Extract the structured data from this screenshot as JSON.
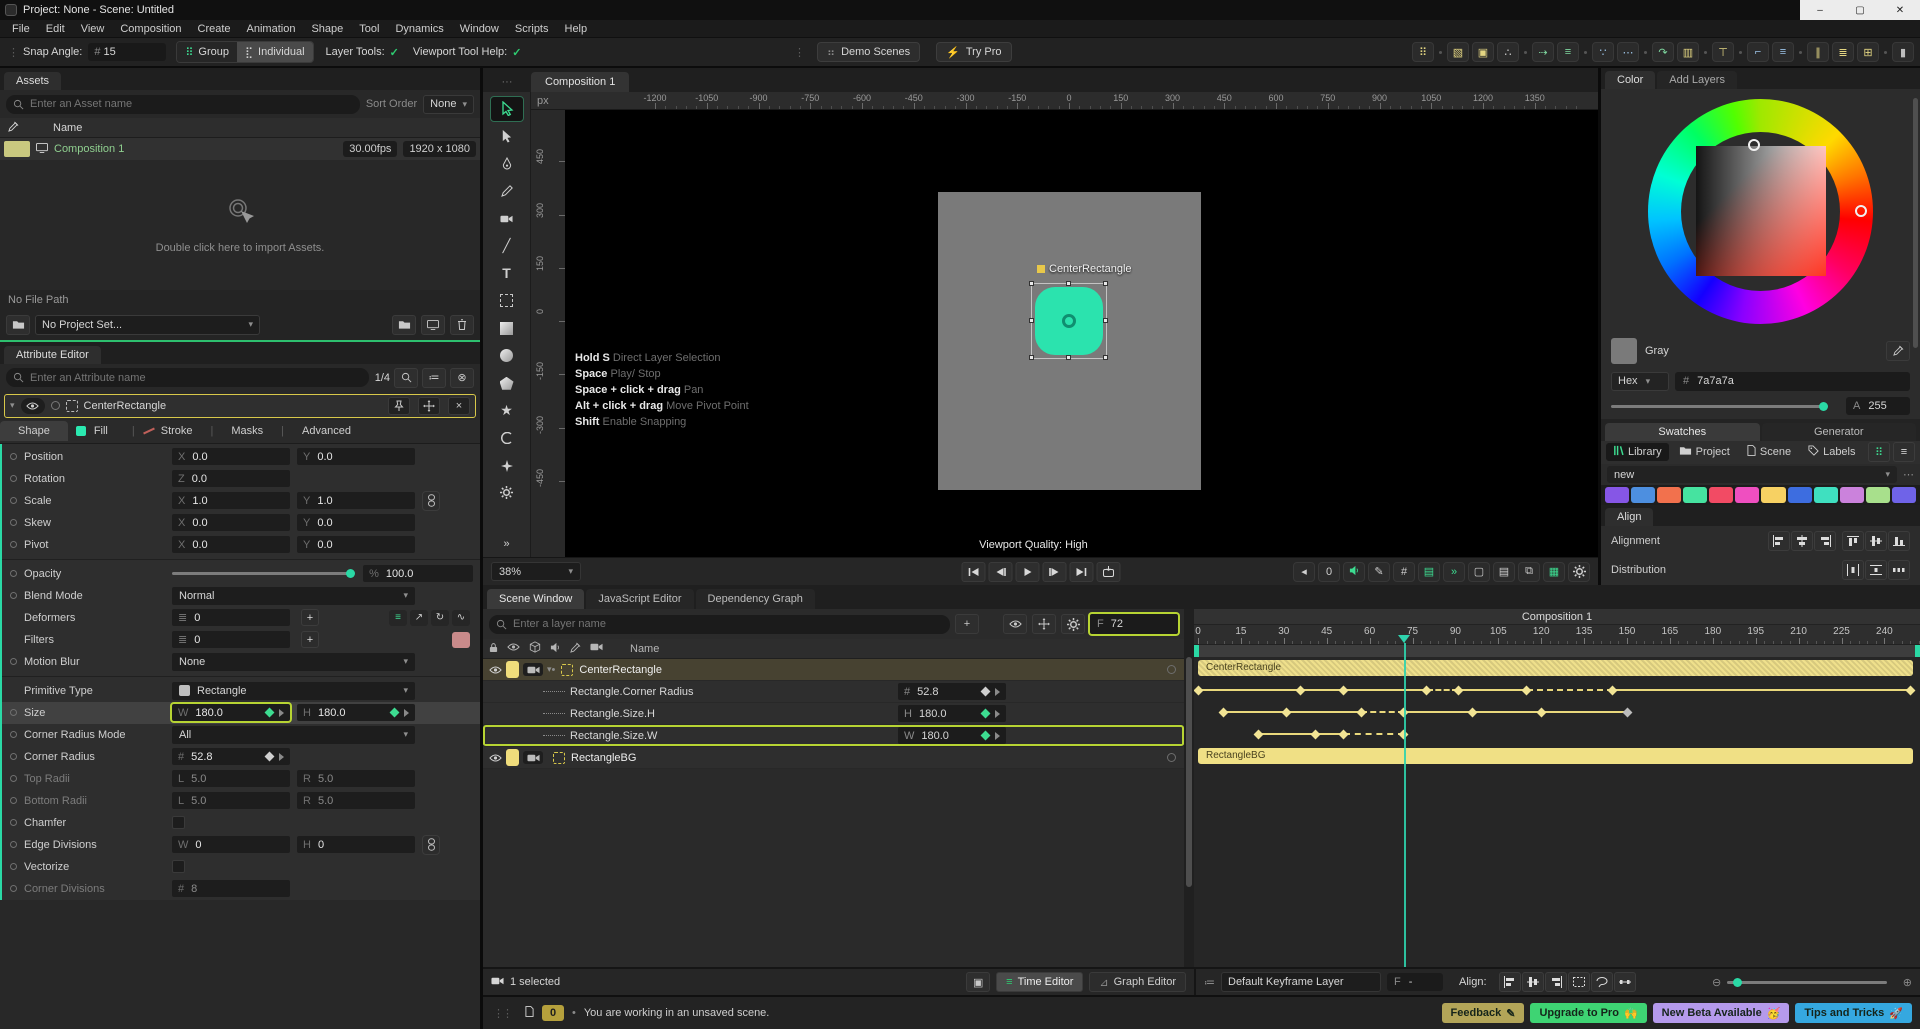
{
  "window": {
    "title": "Project: None - Scene: Untitled",
    "minimize": "–",
    "maximize": "▢",
    "close": "✕"
  },
  "menu": [
    "File",
    "Edit",
    "View",
    "Composition",
    "Create",
    "Animation",
    "Shape",
    "Tool",
    "Dynamics",
    "Window",
    "Scripts",
    "Help"
  ],
  "toolbar": {
    "snap_angle_label": "Snap Angle:",
    "snap_angle_prefix": "#",
    "snap_angle_value": "15",
    "group_label": "Group",
    "individual_label": "Individual",
    "layer_tools_label": "Layer Tools:",
    "layer_tools_check": "✓",
    "viewport_tool_help_label": "Viewport Tool Help:",
    "viewport_tool_help_check": "✓",
    "demo_scenes_label": "Demo Scenes",
    "try_pro_label": "Try Pro",
    "right_icons": [
      "grid-dots-icon",
      "cube-icon",
      "frame-f-icon",
      "particles-icon",
      "motion-path-icon",
      "align-list-icon",
      "hierarchy-icon",
      "ellipsis-icon",
      "rotate-arc-icon",
      "filmstrip-icon",
      "t-pin-icon",
      "align-top-blocks-icon",
      "align-rows-icon",
      "columns-icon",
      "rows-icon",
      "grid-icon",
      "camera-icon"
    ]
  },
  "assets": {
    "tab": "Assets",
    "search_placeholder": "Enter an Asset name",
    "sort_order_label": "Sort Order",
    "sort_order_value": "None",
    "name_header": "Name",
    "composition": {
      "name": "Composition 1",
      "fps": "30.00fps",
      "resolution": "1920 x 1080"
    },
    "import_hint": "Double click here to import Assets.",
    "file_path": "No File Path",
    "project_set": "No Project Set...",
    "footer_icons": [
      "folder-icon",
      "monitor-icon",
      "trash-icon"
    ]
  },
  "attribute_editor": {
    "tab": "Attribute Editor",
    "search_placeholder": "Enter an Attribute name",
    "counter": "1/4",
    "layer_name": "CenterRectangle",
    "tabs": [
      "Shape",
      "Fill",
      "Stroke",
      "Masks",
      "Advanced"
    ],
    "active_tab": "Shape",
    "rows": [
      {
        "label": "Position",
        "dot": true,
        "fields": [
          {
            "p": "X",
            "v": "0.0"
          },
          {
            "p": "Y",
            "v": "0.0"
          }
        ]
      },
      {
        "label": "Rotation",
        "dot": true,
        "fields": [
          {
            "p": "Z",
            "v": "0.0"
          }
        ]
      },
      {
        "label": "Scale",
        "dot": true,
        "fields": [
          {
            "p": "X",
            "v": "1.0"
          },
          {
            "p": "Y",
            "v": "1.0"
          }
        ],
        "link": true
      },
      {
        "label": "Skew",
        "dot": true,
        "fields": [
          {
            "p": "X",
            "v": "0.0"
          },
          {
            "p": "Y",
            "v": "0.0"
          }
        ]
      },
      {
        "label": "Pivot",
        "dot": true,
        "fields": [
          {
            "p": "X",
            "v": "0.0"
          },
          {
            "p": "Y",
            "v": "0.0"
          }
        ]
      },
      {
        "divider": true
      },
      {
        "label": "Opacity",
        "dot": true,
        "slider": 1,
        "suffix": {
          "p": "%",
          "v": "100.0"
        }
      },
      {
        "label": "Blend Mode",
        "dot": true,
        "dropdown": "Normal"
      },
      {
        "label": "Deformers",
        "count": {
          "p": "≣",
          "v": "0"
        },
        "plus": true,
        "right_icons": [
          "list-icon",
          "graph-icon",
          "loop-icon",
          "wave-icon"
        ]
      },
      {
        "label": "Filters",
        "count": {
          "p": "≣",
          "v": "0"
        },
        "plus": true,
        "right_icons": [
          "filter-swatch-icon"
        ]
      },
      {
        "label": "Motion Blur",
        "dot": true,
        "dropdown": "None"
      },
      {
        "divider": true
      },
      {
        "label": "Primitive Type",
        "dropdown": "Rectangle",
        "swatch": "#bfbfbf"
      },
      {
        "label": "Size",
        "dot": true,
        "highlight": true,
        "fields": [
          {
            "p": "W",
            "v": "180.0",
            "key": "green",
            "outlined": true
          },
          {
            "p": "H",
            "v": "180.0",
            "key": "green"
          }
        ]
      },
      {
        "label": "Corner Radius Mode",
        "dot": true,
        "dropdown": "All"
      },
      {
        "label": "Corner Radius",
        "dot": true,
        "fields": [
          {
            "p": "#",
            "v": "52.8",
            "key": "white"
          }
        ]
      },
      {
        "label": "Top Radii",
        "dot": true,
        "dim": true,
        "fields": [
          {
            "p": "L",
            "v": "5.0",
            "dim": true
          },
          {
            "p": "R",
            "v": "5.0",
            "dim": true
          }
        ]
      },
      {
        "label": "Bottom Radii",
        "dot": true,
        "dim": true,
        "fields": [
          {
            "p": "L",
            "v": "5.0",
            "dim": true
          },
          {
            "p": "R",
            "v": "5.0",
            "dim": true
          }
        ]
      },
      {
        "label": "Chamfer",
        "dot": true,
        "checkbox": false
      },
      {
        "label": "Edge Divisions",
        "dot": true,
        "fields": [
          {
            "p": "W",
            "v": "0"
          },
          {
            "p": "H",
            "v": "0"
          }
        ],
        "link": true
      },
      {
        "label": "Vectorize",
        "dot": true,
        "checkbox": false
      },
      {
        "label": "Corner Divisions",
        "dot": true,
        "dim": true,
        "fields": [
          {
            "p": "#",
            "v": "8",
            "dim": true
          }
        ]
      }
    ]
  },
  "viewport": {
    "tab": "Composition 1",
    "ruler_unit": "px",
    "h_ruler": {
      "min": -1200,
      "max": 1350,
      "step": 150
    },
    "v_ruler": {
      "min": -450,
      "max": 450,
      "step": 150
    },
    "tools": [
      "select-tool",
      "direct-select-tool",
      "pen-tool",
      "pencil-tool",
      "camera-tool",
      "line-tool",
      "text-tool",
      "transform-tool",
      "rectangle-tool",
      "ellipse-tool",
      "polygon-tool",
      "star-tool",
      "arc-tool",
      "sparkle-tool",
      "utility-gear-tool",
      "more-tools"
    ],
    "selection_label": "CenterRectangle",
    "bg_layer_color": "#7a7a7a",
    "shape_color": "#2be3ae",
    "help": [
      {
        "key": "Hold S",
        "desc": " Direct Layer Selection"
      },
      {
        "key": "Space",
        "desc": " Play/ Stop"
      },
      {
        "key": "Space + click + drag",
        "desc": " Pan"
      },
      {
        "key": "Alt + click + drag",
        "desc": " Move Pivot Point"
      },
      {
        "key": "Shift",
        "desc": " Enable Snapping"
      }
    ],
    "quality": "Viewport Quality: High",
    "zoom": "38%",
    "transport": [
      "go-to-start",
      "step-back",
      "play",
      "step-forward",
      "go-to-end",
      "loop-export"
    ],
    "right_controls": [
      "camera-back-icon",
      "frame-counter",
      "audio-icon",
      "pen-pressure-icon",
      "grid-hash-icon",
      "render-range-icon",
      "fast-forward-icon",
      "display-frame-icon",
      "layer-stack-icon",
      "duplicate-icon",
      "transparency-checker-icon",
      "viewport-settings-icon"
    ],
    "frame_counter_value": "0"
  },
  "color_panel": {
    "tabs": [
      "Color",
      "Add Layers"
    ],
    "active_tab": "Color",
    "color_name": "Gray",
    "hex_mode": "Hex",
    "hex_prefix": "#",
    "hex_value": "7a7a7a",
    "alpha_prefix": "A",
    "alpha_value": "255",
    "swatch_tabs": [
      "Swatches",
      "Generator"
    ],
    "library_tabs": [
      "Library",
      "Project",
      "Scene",
      "Labels"
    ],
    "palette_name": "new",
    "palette": [
      "#8656e6",
      "#4d8fe0",
      "#f2714d",
      "#46e3a0",
      "#f24b64",
      "#ef4fc0",
      "#f7d163",
      "#3d6de0",
      "#3fe0c0",
      "#cb82dc",
      "#a8e08c",
      "#6f63e8"
    ],
    "align_tab": "Align",
    "alignment_label": "Alignment",
    "alignment_icons": [
      "align-left-icon",
      "align-center-h-icon",
      "align-right-icon",
      "align-top-icon",
      "align-middle-icon",
      "align-bottom-icon"
    ],
    "distribution_label": "Distribution",
    "distribution_icons": [
      "distribute-h-icon",
      "distribute-v-icon",
      "distribute-spacing-icon"
    ]
  },
  "timeline": {
    "tabs": [
      "Scene Window",
      "JavaScript Editor",
      "Dependency Graph"
    ],
    "active_tab": "Scene Window",
    "search_placeholder": "Enter a layer name",
    "toolbar_icons": [
      "onion-skin-icon",
      "move-keys-icon",
      "filter-sliders-icon"
    ],
    "frame_field": {
      "prefix": "F",
      "value": "72"
    },
    "header_icons": [
      "lock-icon",
      "eye-icon",
      "cube-icon",
      "speaker-icon",
      "eyedropper-icon",
      "camera-icon"
    ],
    "name_header": "Name",
    "comp_header": "Composition 1",
    "ruler": {
      "start": 0,
      "end": 240,
      "step": 15,
      "frames_visible": 250
    },
    "playhead_frame": 72,
    "layers": [
      {
        "name": "CenterRectangle",
        "kind": "layer",
        "selected": true
      },
      {
        "name": "Rectangle.Corner Radius",
        "kind": "attribute",
        "value": {
          "p": "#",
          "v": "52.8",
          "key": "white"
        }
      },
      {
        "name": "Rectangle.Size.H",
        "kind": "attribute",
        "value": {
          "p": "H",
          "v": "180.0",
          "key": "green"
        }
      },
      {
        "name": "Rectangle.Size.W",
        "kind": "attribute",
        "value": {
          "p": "W",
          "v": "180.0",
          "key": "green"
        },
        "outlined": true
      },
      {
        "name": "RectangleBG",
        "kind": "layer"
      }
    ],
    "tracks": [
      {
        "type": "bar",
        "label": "CenterRectangle",
        "hatched": true,
        "from": 0,
        "to": 250
      },
      {
        "type": "keys",
        "keys": [
          0,
          36,
          51,
          80,
          91,
          115,
          145,
          249
        ],
        "dashed_segments": [
          [
            80,
            91
          ],
          [
            115,
            145
          ]
        ]
      },
      {
        "type": "keys",
        "keys": [
          9,
          31,
          57,
          72,
          96,
          120,
          150
        ],
        "dashed_segments": [
          [
            57,
            72
          ]
        ],
        "last_key_gray": true
      },
      {
        "type": "keys",
        "keys": [
          21,
          41,
          51,
          72
        ],
        "dashed_segments": [
          [
            51,
            72
          ]
        ]
      },
      {
        "type": "bar",
        "label": "RectangleBG",
        "hatched": false,
        "from": 0,
        "to": 250
      }
    ],
    "footer": {
      "selected": "1 selected",
      "time_editor": "Time Editor",
      "graph_editor": "Graph Editor",
      "keyframe_layer": "Default Keyframe Layer",
      "frame_prefix": "F",
      "frame_value": "-",
      "align_label": "Align:",
      "align_icons": [
        "align-left-icon",
        "align-middle-icon",
        "align-right-icon",
        "select-rect-icon",
        "lasso-icon",
        "distribute-keys-icon"
      ]
    }
  },
  "status_bar": {
    "counter": "0",
    "message": "You are working in an unsaved scene.",
    "badges": [
      {
        "label": "Feedback",
        "emoji": "✎",
        "color": "#b3a558"
      },
      {
        "label": "Upgrade to Pro",
        "emoji": "🙌",
        "color": "#3ed473"
      },
      {
        "label": "New Beta Available",
        "emoji": "🥳",
        "color": "#b59aec"
      },
      {
        "label": "Tips and Tricks",
        "emoji": "🚀",
        "color": "#35a8e0"
      }
    ]
  }
}
